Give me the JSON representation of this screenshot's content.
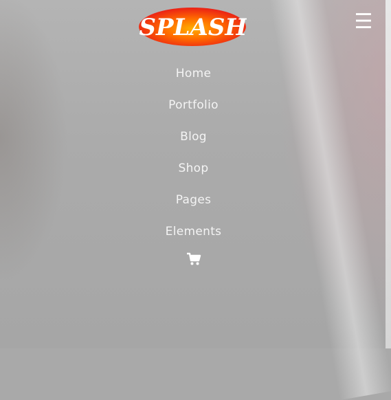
{
  "logo": {
    "text": "SPLASH"
  },
  "menu_toggle": {
    "glyph": "☰",
    "icon": "hamburger-menu-icon"
  },
  "nav": {
    "items": [
      {
        "label": "Home"
      },
      {
        "label": "Portfolio"
      },
      {
        "label": "Blog"
      },
      {
        "label": "Shop"
      },
      {
        "label": "Pages"
      },
      {
        "label": "Elements"
      }
    ]
  },
  "cart": {
    "icon": "shopping-cart-icon"
  },
  "colors": {
    "overlay": "#a9a9a9",
    "nav_text": "#f4f4f4",
    "logo_red": "#e6121a",
    "logo_orange": "#ff9a00"
  }
}
